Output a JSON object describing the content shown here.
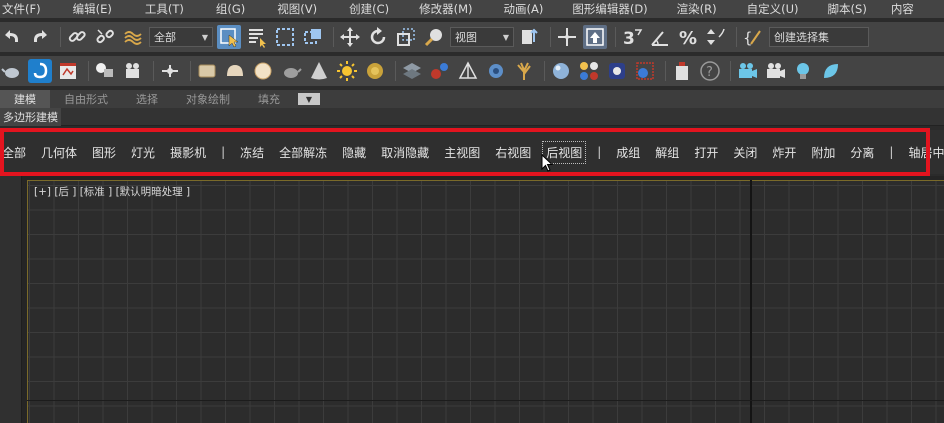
{
  "menu": [
    "文件(F)",
    "编辑(E)",
    "工具(T)",
    "组(G)",
    "视图(V)",
    "创建(C)",
    "修改器(M)",
    "动画(A)",
    "图形编辑器(D)",
    "渲染(R)",
    "自定义(U)",
    "脚本(S)",
    "内容"
  ],
  "toolbar": {
    "selection_filter": "全部",
    "reference_coord": "视图",
    "named_selection": "创建选择集"
  },
  "ribbon": {
    "tabs": [
      "建模",
      "自由形式",
      "选择",
      "对象绘制",
      "填充"
    ],
    "active_tab": "建模",
    "sub_label": "多边形建模"
  },
  "filter_bar": {
    "items": [
      "全部",
      "几何体",
      "图形",
      "灯光",
      "摄影机",
      "|",
      "冻结",
      "全部解冻",
      "隐藏",
      "取消隐藏",
      "主视图",
      "右视图",
      "后视图",
      "|",
      "成组",
      "解组",
      "打开",
      "关闭",
      "炸开",
      "附加",
      "分离",
      "|",
      "轴居中"
    ],
    "hovered": "后视图"
  },
  "viewport": {
    "label": "[+] [后 ] [标准 ] [默认明暗处理 ]"
  },
  "colors": {
    "highlight_frame": "#e3141f",
    "selected_tool": "#5b8ec2",
    "panel": "#444444",
    "viewport_bg": "#2c2c2c"
  },
  "icons": {
    "toolbar1": [
      "undo-icon",
      "redo-icon",
      "link-icon",
      "unlink-icon",
      "bind-space-warp-icon",
      "select-object-icon",
      "select-by-name-icon",
      "rect-selection-icon",
      "window-crossing-icon",
      "move-icon",
      "rotate-icon",
      "scale-icon",
      "placement-icon",
      "use-pivot-icon",
      "mirror-icon",
      "align-icon",
      "snap-3d-icon",
      "angle-snap-icon",
      "percent-snap-icon",
      "spinner-snap-icon",
      "edit-named-sets-icon"
    ],
    "toolbar2": [
      "teapot-icon",
      "modifier-icon",
      "render-frame-icon",
      "light-icon",
      "camera-icon",
      "helper-icon",
      "box-icon",
      "dome-icon",
      "sphere-icon",
      "teapot-icon",
      "cone-icon",
      "sun-icon",
      "disc-icon",
      "grid-icon",
      "particles-icon",
      "shape-icon",
      "gear-icon",
      "plant-icon",
      "ball-icon",
      "dots-icon",
      "photo-icon",
      "render-icon",
      "battery-icon",
      "help-icon",
      "film-camera-icon",
      "movie-camera-icon",
      "bulb-icon",
      "leaf-icon"
    ]
  }
}
